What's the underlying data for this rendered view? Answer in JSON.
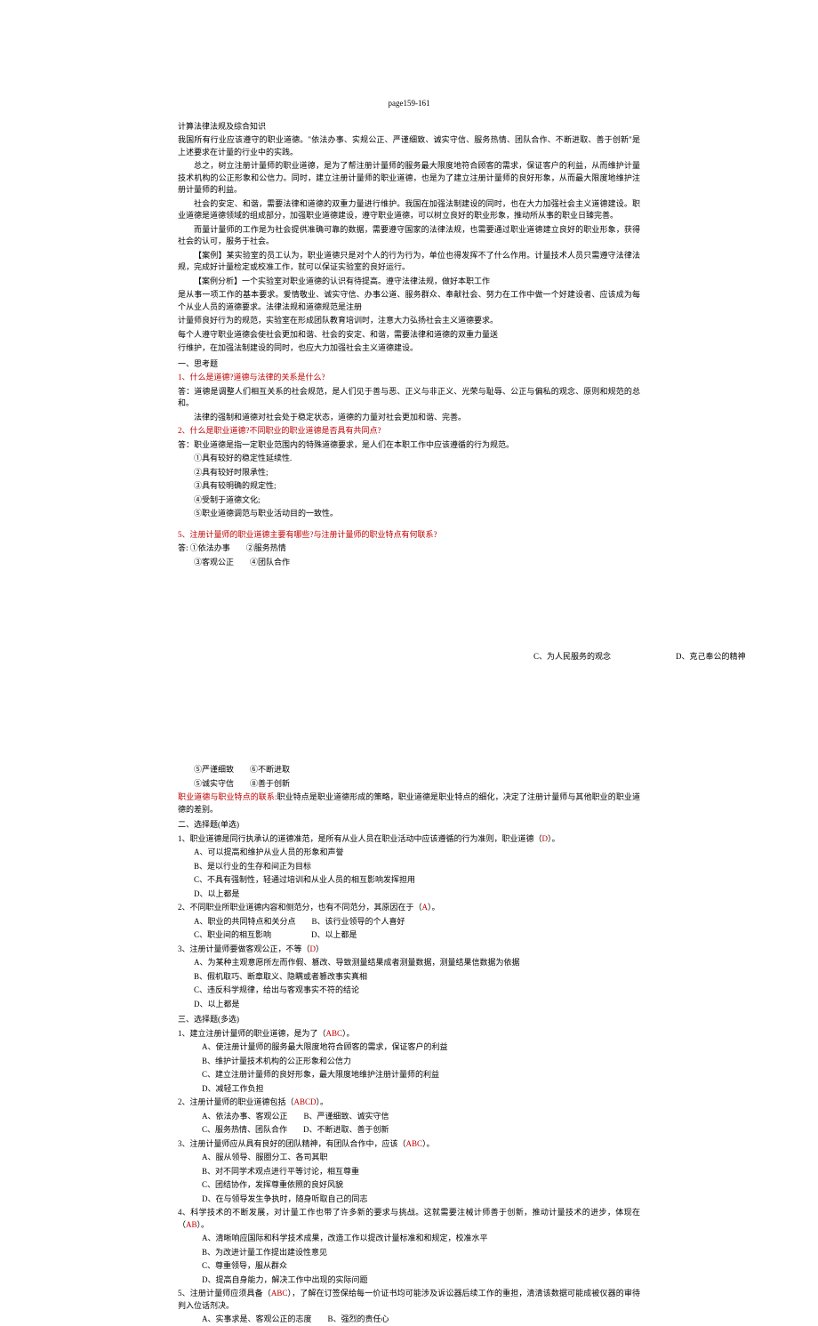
{
  "header": "page159-161",
  "title": "计算法律法规及综合知识",
  "p1": "我国所有行业应该遵守的职业道德。\"依法办事、实规公正、严谨细致、诚实守信、服务热情、团队合作、不断进取、善于创新\"是上述要求在计量的行业中的实践。",
  "p2": "总之，树立注册计量师的职业道德，是为了帮注册计量师的服务最大限度地符合顾客的需求，保证客户的利益，从而维护计量技术机构的公正形象和公信力。同时，建立注册计量师的职业道德，也是为了建立注册计量师的良好形象，从而最大限度地维护注册计量师的利益。",
  "p3": "社会的安定、和谐，需要法律和道德的双重力量进行维护。我国在加强法制建设的同时，也在大力加强社会主义道德建设。职业道德是道德领域的组成部分，加强职业道德建设，遵守职业道德，可以树立良好的职业形象，推动所从事的职业日臻完善。",
  "p4": "而量计量师的工作是为社会提供准确可靠的数据，需要遵守国家的法律法规，也需要通过职业道德建立良好的职业形象，获得社会的认可，服务于社会。",
  "p5": "【案例】某实验室的员工认为，职业道德只是对个人的行为行为，单位也得发挥不了什么作用。计量技术人员只需遵守法律法规，完成好计量检定或校准工作，就可以保证实验室的良好运行。",
  "p6": "【案例分析】一个实验室对职业道德的认识有待提高。遵守法律法规，做好本职工作",
  "p7": "是从事一项工作的基本要求。爱情敬业、诚实守信、办事公道、服务群众、奉献社会、努力在工作中做一个好建设者、应该成为每个从业人员的道德要求。法律法规和道德规范是注册",
  "p8": "计量师良好行为的规范，实验室在形成团队教育培训时，注意大力弘扬社会主义道德要求。",
  "p9": "每个人遵守职业道德会使社会更加和谐、社会的安定、和谐，需要法律和道德的双重力量送",
  "p10": "行维护，在加强法制建设的同时，也应大力加强社会主义道德建设。",
  "s1_title": "一、思考题",
  "s1_q1": "1、什么是道德?道德与法律的关系是什么?",
  "s1_a1": "答：道德是调整人们相互关系的社会规范，是人们见于善与恶、正义与非正义、光荣与耻辱、公正与偏私的观念、原则和规范的总和。",
  "s1_a1b": "法律的强制和道德对社会处于稳定状态，道德的力量对社会更加和谐、完善。",
  "s1_q2": "2、什么是职业道德?不同职业的职业道德是否具有共同点?",
  "s1_a2": "答：职业道德是指一定职业范围内的特殊道德要求，是人们在本职工作中应该遵循的行为规范。",
  "s1_a2_1": "①具有较好的稳定性延续性.",
  "s1_a2_2": "②具有较好时限承性;",
  "s1_a2_3": "③具有较明确的规定性;",
  "s1_a2_4": "④受制于道德文化;",
  "s1_a2_5": "⑤职业道德调范与职业活动目的一致性。",
  "s1_q3": "5、注册计量师的职业道德主要有哪些?与注册计量师的职业特点有何联系?",
  "s1_a3_1": "答: ①依法办事　　②服务热情",
  "s1_a3_2": "③客观公正　　④团队合作",
  "b2_1": "⑤严谨细致　　⑥不断进取",
  "b2_2": "⑤诚实守信　　⑧善于创新",
  "fr_c": "C、为人民服务的观念",
  "fr_d": "D、克己奉公的精神",
  "b2_red": "职业道德与职业特点的联系:",
  "b2_red_after": "职业特点是职业道德形成的策略，职业道德是职业特点的细化，决定了注册计量师与其他职业的职业道德的差别。",
  "s2_title": "二、选择题(单选)",
  "s2_q1": "1、职业道德是同行执承认的道德准范，是所有从业人员在职业活动中应该遵循的行为准则，职业道德（D）。",
  "s2_q1_a": "A、可以提高和维护从业人员的形象和声誉",
  "s2_q1_b": "B、是以行业的生存和间正为目标",
  "s2_q1_c": "C、不具有强制性，轻通过培训和从业人员的相互影响发挥担用",
  "s2_q1_d": "D、以上都是",
  "s2_q2": "2、不同职业所职业道德内容和侧范分，也有不同范分，其原因在于（A）。",
  "s2_q2_a": "A、职业的共同特点和关分点　　B、该行业领导的个人喜好",
  "s2_q2_c": "C、职业间的相互影响　　　　　D、以上都是",
  "s2_q3": "3、注册计量师要做客观公正，不等（D）",
  "s2_q3_a": "A、为某种主观意愿所左而作假、篡改、导致测量结果成者测量数据，测量结果信数据为依据",
  "s2_q3_b": "B、假机取巧、断章取义、隐瞒或者篡改事实真相",
  "s2_q3_c": "C、违反科学规律，给出与客观事实不符的结论",
  "s2_q3_d": "D、以上都是",
  "s3_title": "三、选择题(多选)",
  "s3_q1": "1、建立注册计量师的职业道德，是为了（ABC）。",
  "s3_q1_a": "A、使注册计量师的服务最大限度地符合顾客的需求，保证客户的利益",
  "s3_q1_b": "B、维护计量技术机构的公正形象和公信力",
  "s3_q1_c": "C、建立注册计量师的良好形象，最大限度地维护注册计量师的利益",
  "s3_q1_d": "D、减轻工作负担",
  "s3_q2": "2、注册计量师的职业道德包括（ABCD）。",
  "s3_q2_a": "A、依法办事、客观公正　　B、严谨细致、诚实守信",
  "s3_q2_c": "C、服务热情、团队合作　　D、不断进取、善于创新",
  "s3_q3": "3、注册计量师应从具有良好的团队精神，有团队合作中，应该（ABC）。",
  "s3_q3_a": "A、服从领导、服圈分工、各司其职",
  "s3_q3_b": "B、对不同学术观点进行平等讨论，相互尊重",
  "s3_q3_c": "C、团结协作，发挥尊重依照的良好风貌",
  "s3_q3_d": "D、在与领导发生争执时，随身听取自己的同志",
  "s3_q4": "4、科学技术的不断发展，对计量工作也带了许多新的要求与挑战。这就需要注械计师善于创新，推动计量技术的进步，体现在（AB）。",
  "s3_q4_a": "A、清晰响应国际和科学技术成果，改造工作以提改计量标准和和规定，校准水平",
  "s3_q4_b": "B、为改进计量工作提出建设性意见",
  "s3_q4_c": "C、尊重领导，服从群众",
  "s3_q4_d": "D、提高自身能力，解决工作中出现的实际问题",
  "s3_q5": "5、注册计量师应须具备（ABC），了解在订签保给每一价证书均可能涉及诉讼器后续工作的重担，清清该数据可能成被仪器的审待判入位话剂决。",
  "s3_q5_a": "A、实事求是、客观公正的志度　　B、强烈的责任心"
}
